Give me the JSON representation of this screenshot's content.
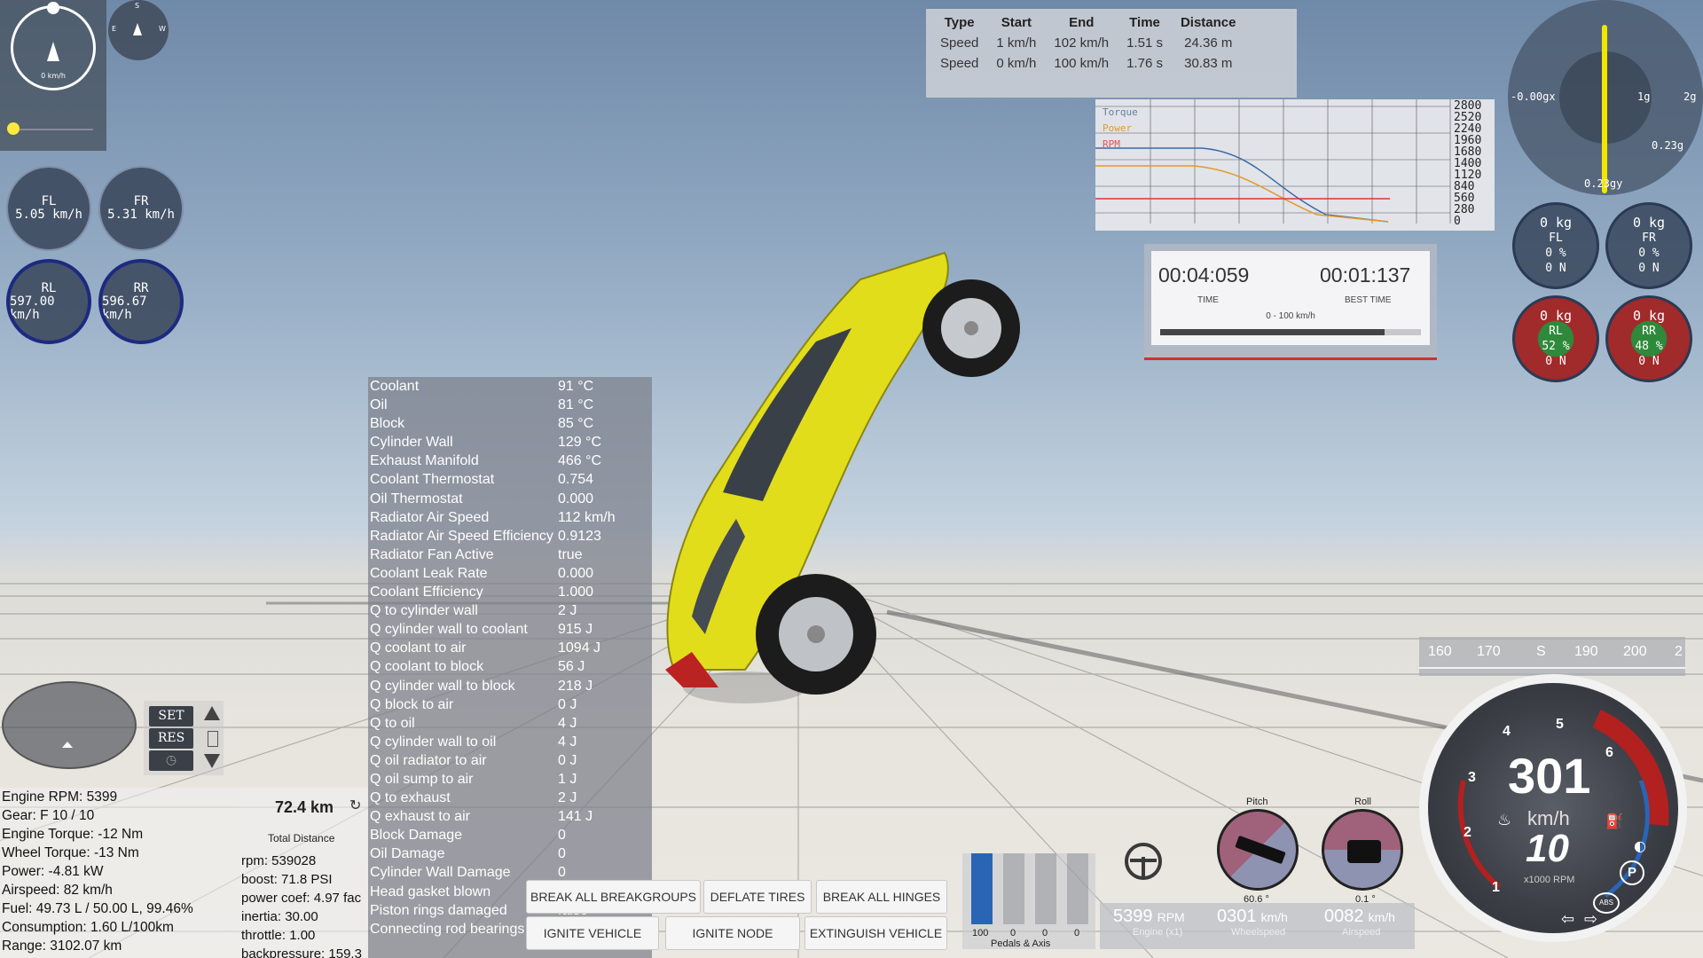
{
  "colors": {
    "accent_blue": "#1d2a80",
    "red": "#b32020",
    "yellow_car": "#e6e21c",
    "gauge_red": "#c02020"
  },
  "top_left": {
    "speed_label": "0 km/h",
    "compass": [
      "S",
      "E",
      "W"
    ]
  },
  "wheels_left": [
    {
      "name": "FL",
      "speed": "5.05 km/h"
    },
    {
      "name": "FR",
      "speed": "5.31 km/h"
    },
    {
      "name": "RL",
      "speed": "597.00 km/h"
    },
    {
      "name": "RR",
      "speed": "596.67 km/h"
    }
  ],
  "perf_table": {
    "headers": [
      "Type",
      "Start",
      "End",
      "Time",
      "Distance"
    ],
    "rows": [
      [
        "Speed",
        "1 km/h",
        "102 km/h",
        "1.51 s",
        "24.36 m"
      ],
      [
        "Speed",
        "0 km/h",
        "100 km/h",
        "1.76 s",
        "30.83 m"
      ]
    ]
  },
  "graph": {
    "legend": [
      "Torque",
      "Power",
      "RPM"
    ],
    "y_ticks": [
      "2800",
      "2520",
      "2240",
      "1960",
      "1680",
      "1400",
      "1120",
      "840",
      "560",
      "280",
      "0"
    ]
  },
  "timer": {
    "time": "00:04:059",
    "time_label": "TIME",
    "best": "00:01:137",
    "best_label": "BEST TIME",
    "subtitle": "0 - 100 km/h",
    "progress": 0.86
  },
  "gmeter": {
    "left": "-0.00gx",
    "r1": "1g",
    "r2": "2g",
    "right": "0.23g",
    "bottom": "0.23gy"
  },
  "wheels_right": [
    {
      "mass": "0 kg",
      "name": "FL",
      "pct": "0 %",
      "force": "0 N"
    },
    {
      "mass": "0 kg",
      "name": "FR",
      "pct": "0 %",
      "force": "0 N"
    },
    {
      "mass": "0 kg",
      "name": "RL",
      "pct": "52 %",
      "force": "0 N"
    },
    {
      "mass": "0 kg",
      "name": "RR",
      "pct": "48 %",
      "force": "0 N"
    }
  ],
  "engine_data": [
    [
      "Coolant",
      "91 °C"
    ],
    [
      "Oil",
      "81 °C"
    ],
    [
      "Block",
      "85 °C"
    ],
    [
      "Cylinder Wall",
      "129 °C"
    ],
    [
      "Exhaust Manifold",
      "466 °C"
    ],
    [
      "Coolant Thermostat",
      "0.754"
    ],
    [
      "Oil Thermostat",
      "0.000"
    ],
    [
      "Radiator Air Speed",
      "112 km/h"
    ],
    [
      "Radiator Air Speed Efficiency",
      "0.9123"
    ],
    [
      "Radiator Fan Active",
      "true"
    ],
    [
      "Coolant Leak Rate",
      "0.000"
    ],
    [
      "Coolant Efficiency",
      "1.000"
    ],
    [
      "Q to cylinder wall",
      "2 J"
    ],
    [
      "Q cylinder wall to coolant",
      "915 J"
    ],
    [
      "Q coolant to air",
      "1094 J"
    ],
    [
      "Q coolant to block",
      "56 J"
    ],
    [
      "Q cylinder wall to block",
      "218 J"
    ],
    [
      "Q block to air",
      "0 J"
    ],
    [
      "Q to oil",
      "4 J"
    ],
    [
      "Q cylinder wall to oil",
      "4 J"
    ],
    [
      "Q oil radiator to air",
      "0 J"
    ],
    [
      "Q oil sump to air",
      "1 J"
    ],
    [
      "Q to exhaust",
      "2 J"
    ],
    [
      "Q exhaust to air",
      "141 J"
    ],
    [
      "Block Damage",
      "0"
    ],
    [
      "Oil Damage",
      "0"
    ],
    [
      "Cylinder Wall Damage",
      "0"
    ],
    [
      "Head gasket blown",
      "false"
    ],
    [
      "Piston rings damaged",
      "false"
    ],
    [
      "Connecting rod bearings damaged",
      "false"
    ]
  ],
  "engine_info": [
    "Engine RPM: 5399",
    "Gear: F 10 / 10",
    "Engine Torque: -12 Nm",
    "Wheel Torque: -13 Nm",
    "Power: -4.81 kW",
    "Airspeed: 82 km/h",
    "Fuel: 49.73 L / 50.00 L, 99.46%",
    "Consumption: 1.60 L/100km",
    "Range: 3102.07 km"
  ],
  "odometer": {
    "value": "72.4 km",
    "label": "Total Distance"
  },
  "turbo_info": [
    "rpm: 539028",
    "boost: 71.8 PSI",
    "power coef: 4.97 fac",
    "inertia: 30.00",
    "throttle: 1.00",
    "backpressure: 159.3"
  ],
  "cruise": {
    "set": "SET",
    "res": "RES"
  },
  "buttons": {
    "break_all_breakgroups": "BREAK ALL BREAKGROUPS",
    "deflate_tires": "DEFLATE TIRES",
    "break_all_hinges": "BREAK ALL HINGES",
    "ignite_vehicle": "IGNITE VEHICLE",
    "ignite_node": "IGNITE NODE",
    "extinguish_vehicle": "EXTINGUISH VEHICLE"
  },
  "pedals": {
    "values": [
      "100",
      "0",
      "0",
      "0"
    ],
    "label": "Pedals & Axis",
    "throttle": 1.0
  },
  "readouts": [
    {
      "value": "5399",
      "unit": "RPM",
      "label": "Engine (x1)"
    },
    {
      "value": "0301",
      "unit": "km/h",
      "label": "Wheelspeed"
    },
    {
      "value": "0082",
      "unit": "km/h",
      "label": "Airspeed"
    }
  ],
  "attitude": {
    "pitch_label": "Pitch",
    "pitch_val": "60.6 °",
    "roll_label": "Roll",
    "roll_val": "0.1 °"
  },
  "heading_tape": [
    "160",
    "170",
    "S",
    "190",
    "200",
    "2"
  ],
  "speedo": {
    "speed": "301",
    "unit": "km/h",
    "gear": "10",
    "rpm_label": "x1000 RPM",
    "ticks": [
      "1",
      "2",
      "3",
      "4",
      "5",
      "6"
    ]
  }
}
